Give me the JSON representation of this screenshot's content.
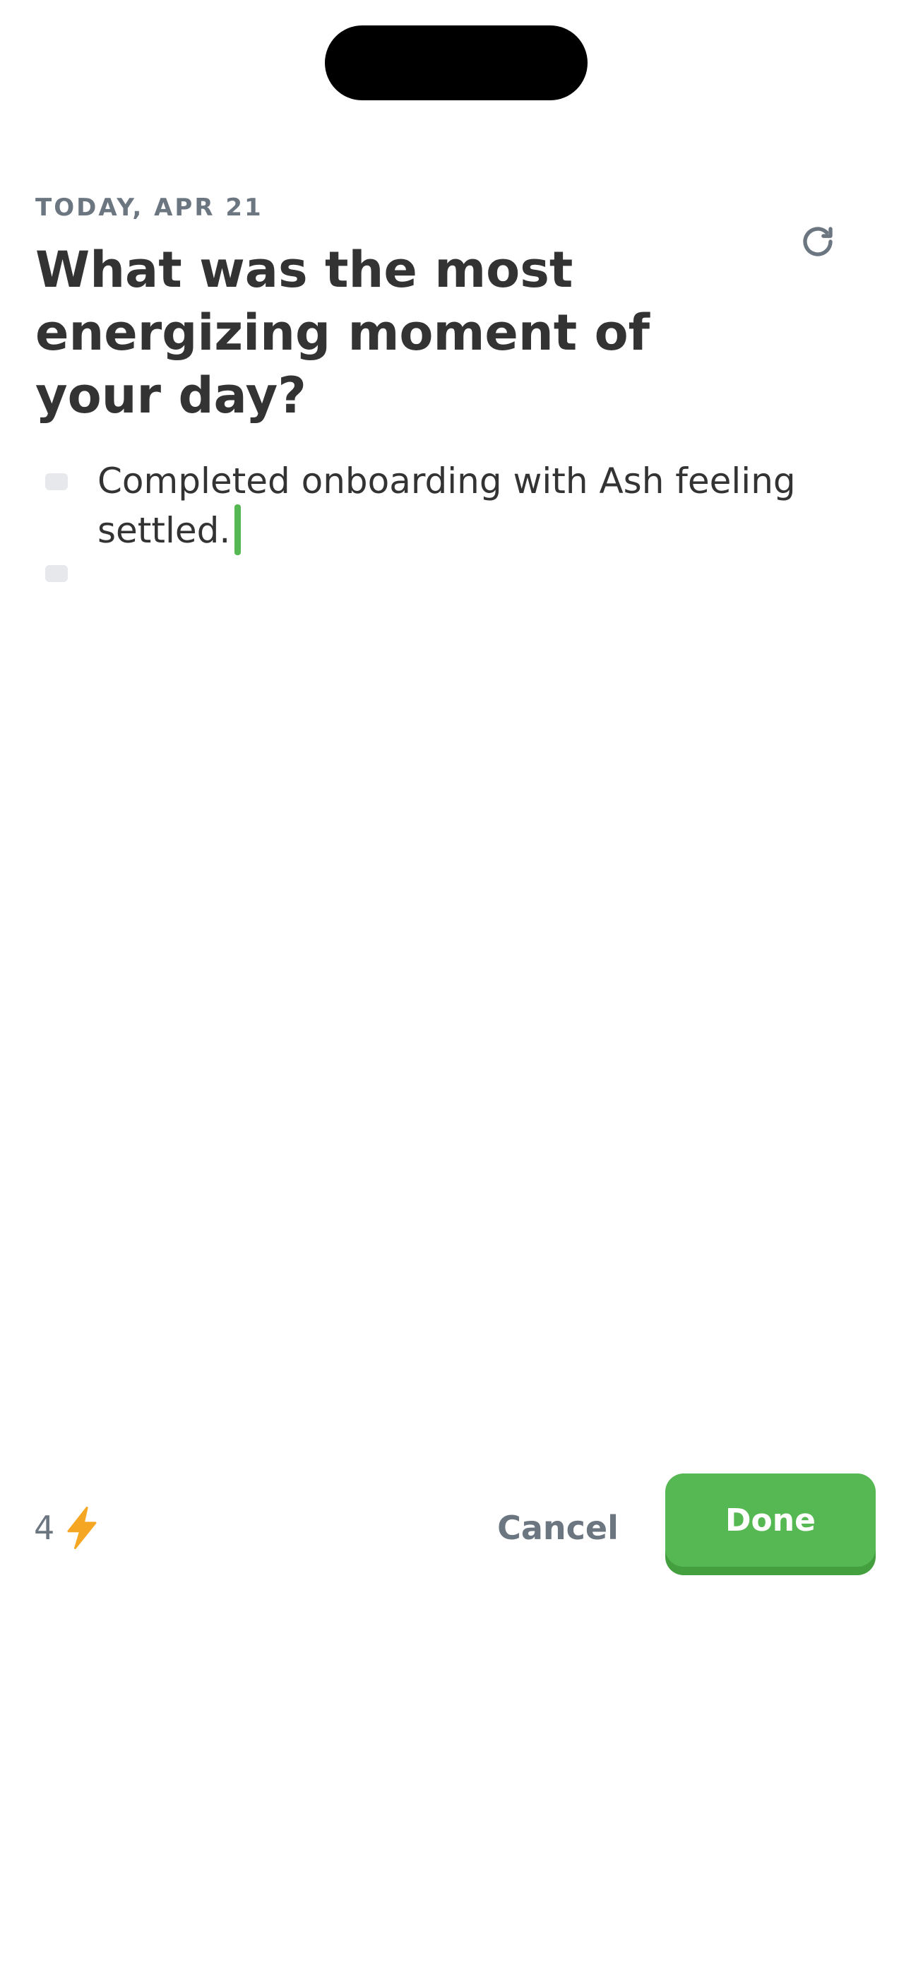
{
  "header": {
    "date_label": "TODAY, APR 21",
    "title": "What was the most energizing moment of your day?"
  },
  "entries": [
    {
      "text": "Completed onboarding with Ash feeling settled."
    },
    {
      "text": ""
    }
  ],
  "footer": {
    "energy_count": "4",
    "cancel_label": "Cancel",
    "done_label": "Done"
  },
  "icons": {
    "refresh": "refresh-icon",
    "energy": "lightning-bolt-icon"
  },
  "colors": {
    "accent_green": "#56b852",
    "accent_green_shadow": "#44a03f",
    "bolt_orange": "#f5a623",
    "muted_gray": "#6b7680",
    "text_dark": "#333333"
  }
}
